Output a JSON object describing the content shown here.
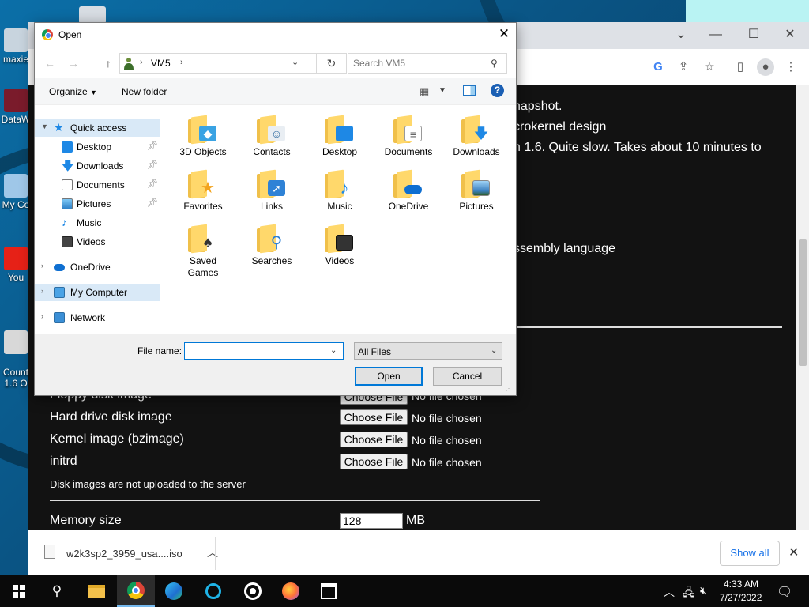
{
  "desktop": {
    "icons": [
      {
        "label": "maxie"
      },
      {
        "label": "DataW"
      },
      {
        "label": "My Co"
      },
      {
        "label": "You"
      },
      {
        "label": "Count\n1.6 O"
      }
    ]
  },
  "browser": {
    "page_lines": [
      "napshot.",
      "crokernel design",
      "n 1.6. Quite slow. Takes about 10 minutes to",
      "ssembly language"
    ],
    "form": {
      "rows": [
        {
          "label": "Floppy disk image",
          "button": "Choose File",
          "status": "No file chosen"
        },
        {
          "label": "Hard drive disk image",
          "button": "Choose File",
          "status": "No file chosen"
        },
        {
          "label": "Kernel image (bzimage)",
          "button": "Choose File",
          "status": "No file chosen"
        },
        {
          "label": "initrd",
          "button": "Choose File",
          "status": "No file chosen"
        }
      ],
      "note": "Disk images are not uploaded to the server",
      "memory_label": "Memory size",
      "memory_value": "128",
      "memory_unit": "MB"
    }
  },
  "download_bar": {
    "file_name": "w2k3sp2_3959_usa....iso",
    "show_all": "Show all"
  },
  "dialog": {
    "title": "Open",
    "address": "VM5",
    "search_placeholder": "Search VM5",
    "organize": "Organize",
    "new_folder": "New folder",
    "nav": [
      {
        "label": "Quick access"
      },
      {
        "label": "Desktop"
      },
      {
        "label": "Downloads"
      },
      {
        "label": "Documents"
      },
      {
        "label": "Pictures"
      },
      {
        "label": "Music"
      },
      {
        "label": "Videos"
      },
      {
        "label": "OneDrive"
      },
      {
        "label": "My Computer"
      },
      {
        "label": "Network"
      }
    ],
    "files": [
      {
        "name": "3D Objects"
      },
      {
        "name": "Contacts"
      },
      {
        "name": "Desktop"
      },
      {
        "name": "Documents"
      },
      {
        "name": "Downloads"
      },
      {
        "name": "Favorites"
      },
      {
        "name": "Links"
      },
      {
        "name": "Music"
      },
      {
        "name": "OneDrive"
      },
      {
        "name": "Pictures"
      },
      {
        "name": "Saved\nGames"
      },
      {
        "name": "Searches"
      },
      {
        "name": "Videos"
      }
    ],
    "file_name_label": "File name:",
    "file_name_value": "",
    "file_type": "All Files",
    "open_button": "Open",
    "cancel_button": "Cancel"
  },
  "taskbar": {
    "time": "4:33 AM",
    "date": "7/27/2022"
  }
}
